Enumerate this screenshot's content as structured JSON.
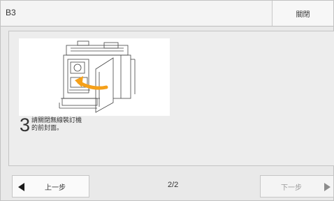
{
  "header": {
    "title": "B3",
    "close_label": "關閉"
  },
  "step": {
    "number": "3",
    "instruction": "請關閉無線裝訂機\n的前封面。"
  },
  "navigation": {
    "prev_label": "上一步",
    "next_label": "下一步",
    "page_indicator": "2/2"
  },
  "illustration": {
    "icon": "finisher-front-cover-close-icon",
    "arrow_color": "#f5a01a"
  },
  "colors": {
    "panel_bg": "#ededed",
    "disabled_text": "#9a9a9a"
  }
}
